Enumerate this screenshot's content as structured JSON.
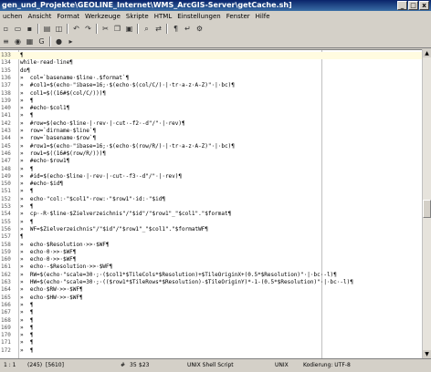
{
  "window": {
    "title": "gen_und_Projekte\\GEOLINE_Internet\\WMS_ArcGIS-Server\\getCache.sh]"
  },
  "menu": [
    "uchen",
    "Ansicht",
    "Format",
    "Werkzeuge",
    "Skripte",
    "HTML",
    "Einstellungen",
    "Fenster",
    "Hilfe"
  ],
  "editor": {
    "lines": [
      {
        "n": "133",
        "text": "¶"
      },
      {
        "n": "134",
        "text": "while·read·line¶"
      },
      {
        "n": "135",
        "text": "do¶"
      },
      {
        "n": "136",
        "text": "»  col=`basename·$line·.$format`¶"
      },
      {
        "n": "137",
        "text": "»  #col1=$(echo·\"ibase=16;·$(echo·$(col/C/)·|·tr·a-z·A-Z)\"·|·bc)¶"
      },
      {
        "n": "138",
        "text": "»  col1=$((16#$(col/C/)))¶"
      },
      {
        "n": "139",
        "text": "»  ¶"
      },
      {
        "n": "140",
        "text": "»  #echo·$col1¶"
      },
      {
        "n": "141",
        "text": "»  ¶"
      },
      {
        "n": "142",
        "text": "»  #row=$(echo·$line·|·rev·|·cut·-f2·-d\"/\"·|·rev)¶"
      },
      {
        "n": "143",
        "text": "»  row=`dirname·$line`¶"
      },
      {
        "n": "144",
        "text": "»  row=`basename·$row`¶"
      },
      {
        "n": "145",
        "text": "»  #row1=$(echo·\"ibase=16;·$(echo·$(row/R/)·|·tr·a-z·A-Z)\"·|·bc)¶"
      },
      {
        "n": "146",
        "text": "»  row1=$((16#$(row/R/)))¶"
      },
      {
        "n": "147",
        "text": "»  #echo·$row1¶"
      },
      {
        "n": "148",
        "text": "»  ¶"
      },
      {
        "n": "149",
        "text": "»  #id=$(echo·$line·|·rev·|·cut·-f3·-d\"/\"·|·rev)¶"
      },
      {
        "n": "150",
        "text": "»  #echo·$id¶"
      },
      {
        "n": "151",
        "text": "»  ¶"
      },
      {
        "n": "152",
        "text": "»  echo·\"col:·\"$col1\"·row:·\"$row1\"·id:·\"$id¶"
      },
      {
        "n": "153",
        "text": "»  ¶"
      },
      {
        "n": "154",
        "text": "»  cp·-R·$line·$Zielverzeichnis\"/\"$id\"/\"$row1\"_\"$col1\".\"$format¶"
      },
      {
        "n": "155",
        "text": "»  ¶"
      },
      {
        "n": "156",
        "text": "»  WF=$Zielverzeichnis\"/\"$id\"/\"$row1\"_\"$col1\".\"$formatWF¶"
      },
      {
        "n": "157",
        "text": "¶"
      },
      {
        "n": "158",
        "text": "»  echo·$Resolution·>>·$WF¶"
      },
      {
        "n": "159",
        "text": "»  echo·0·>>·$WF¶"
      },
      {
        "n": "160",
        "text": "»  echo·0·>>·$WF¶"
      },
      {
        "n": "161",
        "text": "»  echo·-$Resolution·>>·$WF¶"
      },
      {
        "n": "162",
        "text": "»  RW=$(echo·\"scale=30·;·($col1*$TileCols*$Resolution)+$TileOriginX+(0.5*$Resolution)\"·|·bc·-l)¶"
      },
      {
        "n": "163",
        "text": "»  HW=$(echo·\"scale=30·;·(($row1*$TileRows*$Resolution)-$TileOriginY)*-1-(0.5*$Resolution)\"·|·bc·-l)¶"
      },
      {
        "n": "164",
        "text": "»  echo·$RW·>>·$WF¶"
      },
      {
        "n": "165",
        "text": "»  echo·$HW·>>·$WF¶"
      },
      {
        "n": "166",
        "text": "»  ¶"
      },
      {
        "n": "167",
        "text": "»  ¶"
      },
      {
        "n": "168",
        "text": "»  ¶"
      },
      {
        "n": "169",
        "text": "»  ¶"
      },
      {
        "n": "170",
        "text": "»  ¶"
      },
      {
        "n": "171",
        "text": "»  ¶"
      },
      {
        "n": "172",
        "text": "»  ¶"
      }
    ]
  },
  "status": {
    "position": "1 : 1",
    "chars": "(245)",
    "size": "[5610]",
    "hash": "#",
    "col1": "35",
    "col2": "$23",
    "script_type": "UNIX Shell Script",
    "line_ending": "UNIX",
    "encoding": "Kodierung: UTF-8"
  }
}
